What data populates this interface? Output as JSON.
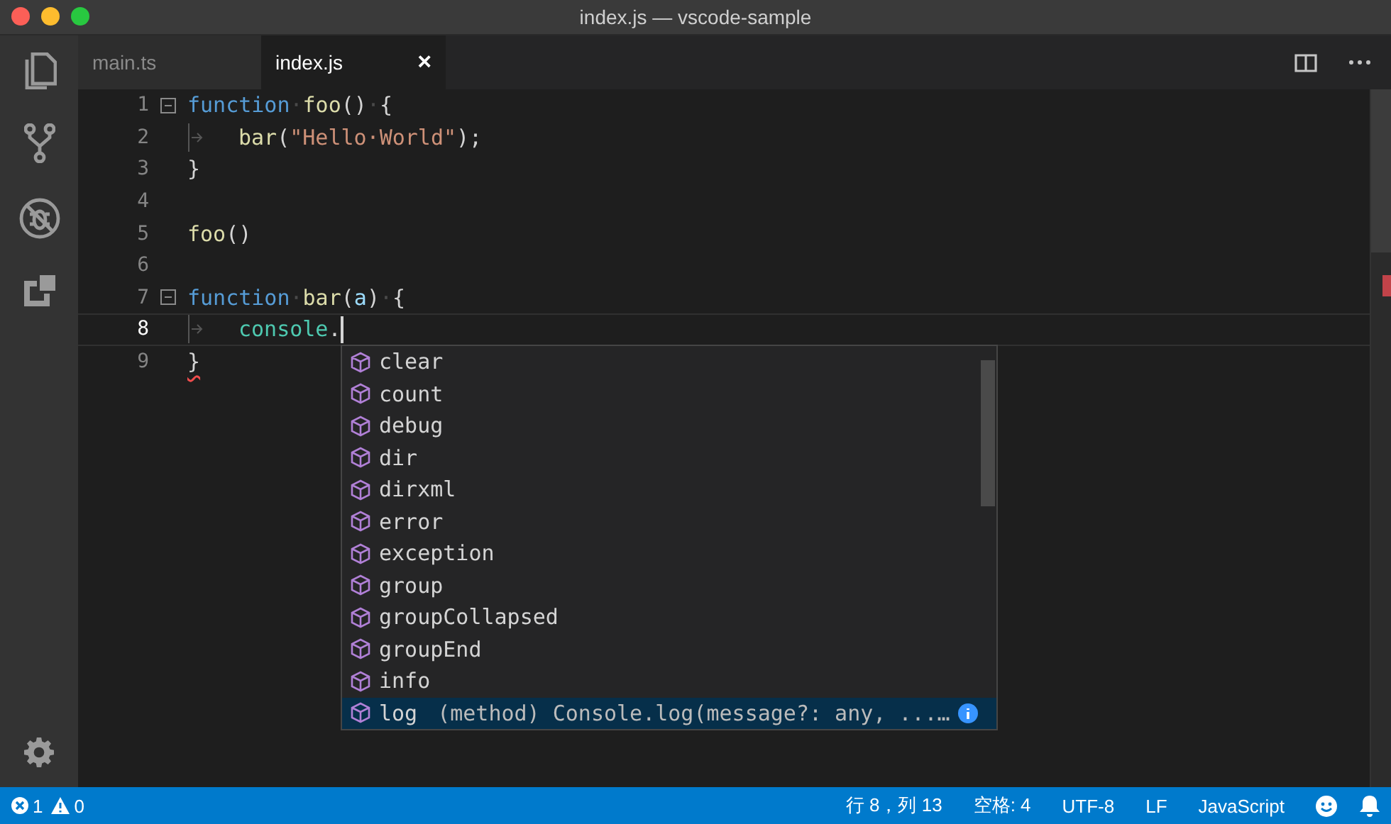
{
  "window": {
    "title": "index.js — vscode-sample"
  },
  "activity_bar": {
    "items": [
      {
        "kind": "files"
      },
      {
        "kind": "git"
      },
      {
        "kind": "debug"
      },
      {
        "kind": "extensions"
      }
    ]
  },
  "tabs": [
    {
      "label": "main.ts",
      "selected": false
    },
    {
      "label": "index.js",
      "selected": true,
      "close": "×"
    }
  ],
  "editor": {
    "lines": [
      {
        "number": "1",
        "foldable": true,
        "indent": false,
        "current": false,
        "error": false,
        "tokens": [
          {
            "kind": "keyword",
            "text": "function"
          },
          {
            "kind": "whitespace",
            "text": "·"
          },
          {
            "kind": "function",
            "text": "foo"
          },
          {
            "kind": "plain",
            "text": "()"
          },
          {
            "kind": "whitespace",
            "text": "·"
          },
          {
            "kind": "plain",
            "text": "{"
          }
        ]
      },
      {
        "number": "2",
        "foldable": false,
        "indent": true,
        "current": false,
        "error": false,
        "tokens": [
          {
            "kind": "function",
            "text": "bar"
          },
          {
            "kind": "plain",
            "text": "("
          },
          {
            "kind": "string",
            "text": "\"Hello·World\""
          },
          {
            "kind": "plain",
            "text": ");"
          }
        ]
      },
      {
        "number": "3",
        "foldable": false,
        "indent": false,
        "current": false,
        "error": false,
        "tokens": [
          {
            "kind": "plain",
            "text": "}"
          }
        ]
      },
      {
        "number": "4",
        "foldable": false,
        "indent": false,
        "current": false,
        "error": false
      },
      {
        "number": "5",
        "foldable": false,
        "indent": false,
        "current": false,
        "error": false,
        "tokens": [
          {
            "kind": "function",
            "text": "foo"
          },
          {
            "kind": "plain",
            "text": "()"
          }
        ]
      },
      {
        "number": "6",
        "foldable": false,
        "indent": false,
        "current": false,
        "error": false
      },
      {
        "number": "7",
        "foldable": true,
        "indent": false,
        "current": false,
        "error": false,
        "tokens": [
          {
            "kind": "keyword",
            "text": "function"
          },
          {
            "kind": "whitespace",
            "text": "·"
          },
          {
            "kind": "function",
            "text": "bar"
          },
          {
            "kind": "plain",
            "text": "("
          },
          {
            "kind": "variable",
            "text": "a"
          },
          {
            "kind": "plain",
            "text": ")"
          },
          {
            "kind": "whitespace",
            "text": "·"
          },
          {
            "kind": "plain",
            "text": "{"
          }
        ]
      },
      {
        "number": "8",
        "foldable": false,
        "indent": true,
        "current": true,
        "error": false,
        "tokens": [
          {
            "kind": "class",
            "text": "console"
          },
          {
            "kind": "plain",
            "text": "."
          }
        ]
      },
      {
        "number": "9",
        "foldable": false,
        "indent": false,
        "current": false,
        "error": true,
        "tokens": [
          {
            "kind": "plain",
            "text": "}"
          }
        ]
      }
    ]
  },
  "suggestions": [
    {
      "label": "clear",
      "selected": false
    },
    {
      "label": "count",
      "selected": false
    },
    {
      "label": "debug",
      "selected": false
    },
    {
      "label": "dir",
      "selected": false
    },
    {
      "label": "dirxml",
      "selected": false
    },
    {
      "label": "error",
      "selected": false
    },
    {
      "label": "exception",
      "selected": false
    },
    {
      "label": "group",
      "selected": false
    },
    {
      "label": "groupCollapsed",
      "selected": false
    },
    {
      "label": "groupEnd",
      "selected": false
    },
    {
      "label": "info",
      "selected": false
    },
    {
      "label": "log",
      "selected": true,
      "detail": "(method) Console.log(message?: any, ...…"
    }
  ],
  "status_bar": {
    "errors": "1",
    "warnings": "0",
    "items": [
      "行 8，列 13",
      "空格: 4",
      "UTF-8",
      "LF",
      "JavaScript"
    ]
  }
}
